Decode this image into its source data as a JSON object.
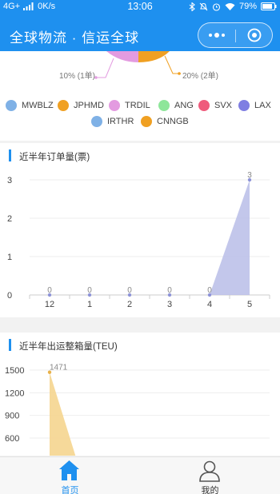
{
  "status_bar": {
    "network": "4G+",
    "speed": "0K/s",
    "time": "13:06",
    "battery": "79%"
  },
  "navbar": {
    "title": "全球物流 · 信运全球"
  },
  "pie": {
    "labels": [
      {
        "text": "10% (1单)",
        "color": "#e39be0"
      },
      {
        "text": "20% (2单)",
        "color": "#f0a022"
      }
    ],
    "legend": [
      {
        "name": "MWBLZ",
        "color": "#7fb1e6"
      },
      {
        "name": "JPHMD",
        "color": "#f0a022"
      },
      {
        "name": "TRDIL",
        "color": "#e39be0"
      },
      {
        "name": "ANG",
        "color": "#8ee69a"
      },
      {
        "name": "SVX",
        "color": "#ef5b7c"
      },
      {
        "name": "LAX",
        "color": "#7f7ee2"
      },
      {
        "name": "IRTHR",
        "color": "#7fb1e6"
      },
      {
        "name": "CNNGB",
        "color": "#f0a022"
      }
    ]
  },
  "orders_section": {
    "title": "近半年订单量(票)"
  },
  "teu_section": {
    "title": "近半年出运整箱量(TEU)"
  },
  "chart_data": [
    {
      "type": "area",
      "title": "近半年订单量(票)",
      "categories": [
        "12",
        "1",
        "2",
        "3",
        "4",
        "5"
      ],
      "series": [
        {
          "values": [
            0,
            0,
            0,
            0,
            0,
            3
          ]
        }
      ],
      "data_labels": [
        "0",
        "0",
        "0",
        "0",
        "0",
        "3"
      ],
      "y_ticks": [
        "0",
        "1",
        "2",
        "3"
      ],
      "ylim": [
        0,
        3
      ],
      "color": "#b9bde8",
      "grid": true
    },
    {
      "type": "area",
      "title": "近半年出运整箱量(TEU)",
      "series": [
        {
          "values": [
            1471
          ]
        }
      ],
      "data_labels": [
        "1471"
      ],
      "y_ticks": [
        "600",
        "900",
        "1200",
        "1500"
      ],
      "color": "#f5d58f",
      "grid": true
    }
  ],
  "tabbar": {
    "home": {
      "label": "首页",
      "color": "#1e90ef"
    },
    "mine": {
      "label": "我的",
      "color": "#333333"
    }
  }
}
